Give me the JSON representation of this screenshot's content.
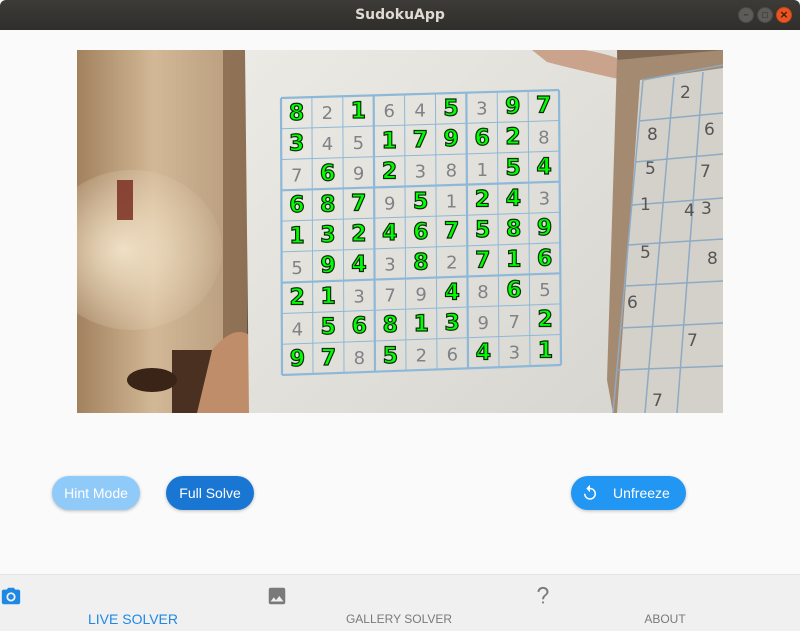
{
  "window": {
    "title": "SudokuApp"
  },
  "colors": {
    "accent": "#1e88e5",
    "digit_overlay": "#00ff00",
    "hint_button": "#90caf9",
    "full_button": "#1976d2",
    "unfreeze_button": "#2196f3"
  },
  "camera": {
    "grid": [
      [
        "8",
        "2",
        "1",
        "6",
        "4",
        "5",
        "3",
        "9",
        "7"
      ],
      [
        "3",
        "4",
        "5",
        "1",
        "7",
        "9",
        "6",
        "2",
        "8"
      ],
      [
        "7",
        "6",
        "9",
        "2",
        "3",
        "8",
        "1",
        "5",
        "4"
      ],
      [
        "6",
        "8",
        "7",
        "9",
        "5",
        "1",
        "2",
        "4",
        "3"
      ],
      [
        "1",
        "3",
        "2",
        "4",
        "6",
        "7",
        "5",
        "8",
        "9"
      ],
      [
        "5",
        "9",
        "4",
        "3",
        "8",
        "2",
        "7",
        "1",
        "6"
      ],
      [
        "2",
        "1",
        "3",
        "7",
        "9",
        "4",
        "8",
        "6",
        "5"
      ],
      [
        "4",
        "5",
        "6",
        "8",
        "1",
        "3",
        "9",
        "7",
        "2"
      ],
      [
        "9",
        "7",
        "8",
        "5",
        "2",
        "6",
        "4",
        "3",
        "1"
      ]
    ],
    "solved": [
      [
        1,
        0,
        1,
        0,
        0,
        1,
        0,
        1,
        1
      ],
      [
        1,
        0,
        0,
        1,
        1,
        1,
        1,
        1,
        0
      ],
      [
        0,
        1,
        0,
        1,
        0,
        0,
        0,
        1,
        1
      ],
      [
        1,
        1,
        1,
        0,
        1,
        0,
        1,
        1,
        0
      ],
      [
        1,
        1,
        1,
        1,
        1,
        1,
        1,
        1,
        1
      ],
      [
        0,
        1,
        1,
        0,
        1,
        0,
        1,
        1,
        1
      ],
      [
        1,
        1,
        0,
        0,
        0,
        1,
        0,
        1,
        0
      ],
      [
        0,
        1,
        1,
        1,
        1,
        1,
        0,
        0,
        1
      ],
      [
        1,
        1,
        0,
        1,
        0,
        0,
        1,
        0,
        1
      ]
    ],
    "background_puzzle": {
      "digits": [
        "2",
        "6",
        "8",
        "7",
        "5",
        "3",
        "1",
        "4",
        "5",
        "8",
        "6",
        "7",
        "7"
      ]
    }
  },
  "buttons": {
    "hint_mode": "Hint Mode",
    "full_solve": "Full Solve",
    "unfreeze": "Unfreeze"
  },
  "nav": {
    "live_solver": {
      "label": "LIVE SOLVER",
      "icon": "camera-icon"
    },
    "gallery_solver": {
      "label": "GALLERY SOLVER",
      "icon": "image-icon"
    },
    "about": {
      "label": "ABOUT",
      "icon": "question-icon"
    }
  }
}
